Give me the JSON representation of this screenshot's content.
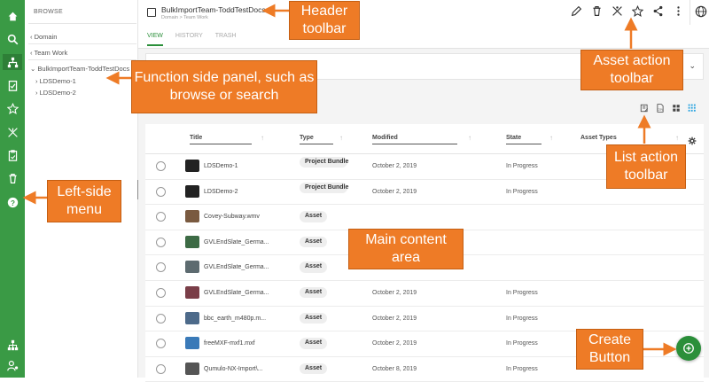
{
  "sidepanel": {
    "title": "BROWSE",
    "items": [
      {
        "label": "Domain"
      },
      {
        "label": "Team Work"
      },
      {
        "label": "BulkImportTeam-ToddTestDocs"
      },
      {
        "label": "LDSDemo-1"
      },
      {
        "label": "LDSDemo-2"
      }
    ]
  },
  "header": {
    "title": "BulkImportTeam-ToddTestDocs",
    "breadcrumb": "Domain > Team Work",
    "tabs": [
      {
        "label": "VIEW"
      },
      {
        "label": "HISTORY"
      },
      {
        "label": "TRASH"
      }
    ]
  },
  "table": {
    "columns": [
      "Title",
      "Type",
      "Modified",
      "State",
      "Asset Types"
    ],
    "rows": [
      {
        "title": "LDSDemo-1",
        "type": "Project Bundle",
        "modified": "October 2, 2019",
        "state": "In Progress",
        "thumb": "#222222"
      },
      {
        "title": "LDSDemo-2",
        "type": "Project Bundle",
        "modified": "October 2, 2019",
        "state": "In Progress",
        "thumb": "#222222"
      },
      {
        "title": "Covey-Subway.wmv",
        "type": "Asset",
        "modified": "",
        "state": "",
        "thumb": "#7a5a40"
      },
      {
        "title": "GVLEndSlate_Germa...",
        "type": "Asset",
        "modified": "",
        "state": "",
        "thumb": "#3d6b45"
      },
      {
        "title": "GVLEndSlate_Germa...",
        "type": "Asset",
        "modified": "",
        "state": "",
        "thumb": "#5d6b70"
      },
      {
        "title": "GVLEndSlate_Germa...",
        "type": "Asset",
        "modified": "October 2, 2019",
        "state": "In Progress",
        "thumb": "#7a3e48"
      },
      {
        "title": "bbc_earth_m480p.m...",
        "type": "Asset",
        "modified": "October 2, 2019",
        "state": "In Progress",
        "thumb": "#4d6a8a"
      },
      {
        "title": "freeMXF-mxf1.mxf",
        "type": "Asset",
        "modified": "October 2, 2019",
        "state": "In Progress",
        "thumb": "#3a7ab8"
      },
      {
        "title": "Qumulo-NX-Import\\...",
        "type": "Asset",
        "modified": "October 8, 2019",
        "state": "In Progress",
        "thumb": "#555555"
      }
    ]
  },
  "callouts": {
    "header_toolbar": "Header toolbar",
    "function_panel": "Function side panel, such as browse or search",
    "asset_toolbar": "Asset action toolbar",
    "list_toolbar": "List action toolbar",
    "left_menu": "Left-side menu",
    "main_area": "Main content area",
    "create_button": "Create Button"
  },
  "colors": {
    "nav_green": "#3a9a45",
    "accent_green": "#2b8f3a",
    "callout_orange": "#ee7b26"
  }
}
